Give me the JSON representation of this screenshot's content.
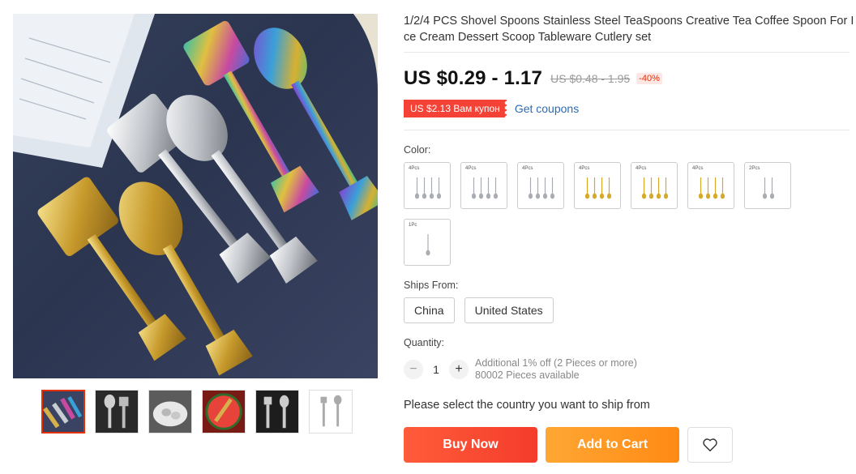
{
  "product": {
    "title": "1/2/4 PCS Shovel Spoons Stainless Steel TeaSpoons Creative Tea Coffee Spoon For Ice Cream Dessert Scoop Tableware Cutlery set",
    "price": "US $0.29 - 1.17",
    "old_price": "US $0.48 - 1.95",
    "discount": "-40%"
  },
  "coupon": {
    "badge": "US $2.13 Вам купон",
    "link": "Get coupons"
  },
  "color": {
    "label": "Color:",
    "options": [
      {
        "pcs": "4Pcs",
        "tone": "silver",
        "count": 4
      },
      {
        "pcs": "4Pcs",
        "tone": "silver",
        "count": 4
      },
      {
        "pcs": "4Pcs",
        "tone": "silver",
        "count": 4
      },
      {
        "pcs": "4Pcs",
        "tone": "gold",
        "count": 4
      },
      {
        "pcs": "4Pcs",
        "tone": "gold",
        "count": 4
      },
      {
        "pcs": "4Pcs",
        "tone": "gold",
        "count": 4
      },
      {
        "pcs": "2Pcs",
        "tone": "silver",
        "count": 2
      },
      {
        "pcs": "1Pc",
        "tone": "silver",
        "count": 1
      }
    ]
  },
  "shipping": {
    "label": "Ships From:",
    "options": [
      "China",
      "United States"
    ],
    "message": "Please select the country you want to ship from"
  },
  "quantity": {
    "label": "Quantity:",
    "minus": "−",
    "value": "1",
    "plus": "+",
    "info_1": "Additional 1% off (2 Pieces or more)",
    "info_2": "80002 Pieces available"
  },
  "actions": {
    "buy_now": "Buy Now",
    "add_to_cart": "Add to Cart",
    "wishlist_icon": "heart-icon"
  },
  "gallery": {
    "thumbnails": [
      "spoons-set",
      "spoons-dark",
      "spoons-plate",
      "watermelon",
      "spoons-black",
      "spoons-white"
    ],
    "active_thumbnail": 0
  },
  "colors": {
    "accent": "#e62e04",
    "buy": "#f43c2b",
    "cart": "#ff8a14",
    "link": "#2e6bb1"
  }
}
